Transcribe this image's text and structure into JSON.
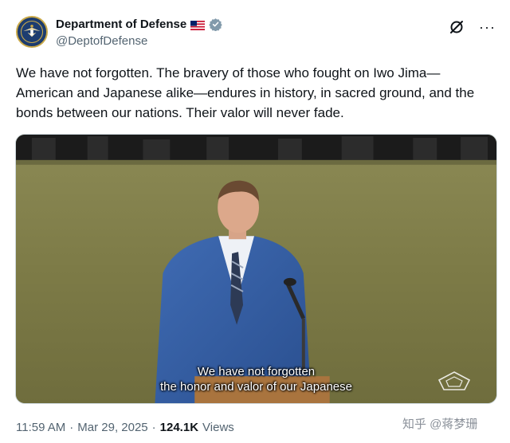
{
  "author": {
    "display_name": "Department of Defense",
    "handle": "@DeptofDefense",
    "flag_icon": "us-flag-icon",
    "verified_icon": "verified-badge-icon",
    "verified_color": "#829aab"
  },
  "header_actions": {
    "grok_icon": "grok-icon",
    "more_label": "···"
  },
  "tweet": {
    "text": "We have not forgotten. The bravery of those who fought on Iwo Jima—American and Japanese alike—endures in history, in sacred ground, and the bonds between our nations. Their valor will never fade."
  },
  "media": {
    "type": "video",
    "caption_line_1": "We have not forgotten",
    "caption_line_2": "the honor and valor of our Japanese",
    "watermark_icon": "pentagon-logo-icon"
  },
  "meta": {
    "time": "11:59 AM",
    "separator": "·",
    "date": "Mar 29, 2025",
    "views_count": "124.1K",
    "views_label": "Views"
  },
  "site_watermark": {
    "text": "知乎 @蒋梦珊"
  },
  "colors": {
    "text_primary": "#0f1419",
    "text_secondary": "#536471",
    "border": "#cfd9de"
  }
}
